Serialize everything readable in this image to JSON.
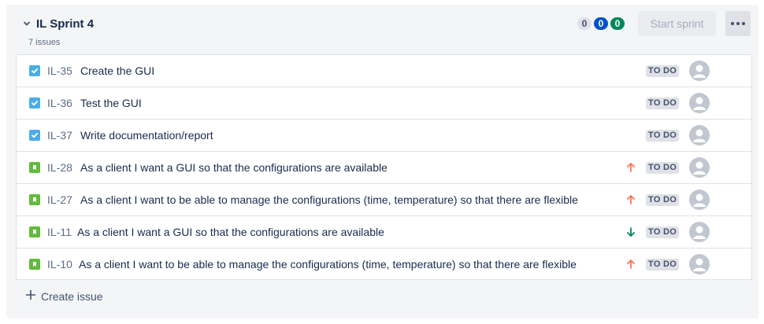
{
  "sprint": {
    "title": "IL Sprint 4",
    "issue_count": "7 issues",
    "badges": {
      "todo": "0",
      "in_progress": "0",
      "done": "0"
    },
    "start_button": "Start sprint",
    "create_issue": "Create issue"
  },
  "issues": [
    {
      "type": "task-icon",
      "key": "IL-35",
      "summary": "Create the GUI",
      "priority": "",
      "status": "TO DO"
    },
    {
      "type": "task-icon",
      "key": "IL-36",
      "summary": "Test the GUI",
      "priority": "",
      "status": "TO DO"
    },
    {
      "type": "task-icon",
      "key": "IL-37",
      "summary": "Write documentation/report",
      "priority": "",
      "status": "TO DO"
    },
    {
      "type": "story-icon",
      "key": "IL-28",
      "summary": "As a client I want a GUI so that the configurations are available",
      "priority": "high",
      "status": "TO DO"
    },
    {
      "type": "story-icon",
      "key": "IL-27",
      "summary": "As a client I want to be able to manage the configurations (time, temperature) so that there are flexible",
      "priority": "high",
      "status": "TO DO"
    },
    {
      "type": "story-icon",
      "key": "IL-11",
      "summary": "As a client I want a GUI so that the configurations are available",
      "priority": "low",
      "status": "TO DO"
    },
    {
      "type": "story-icon",
      "key": "IL-10",
      "summary": "As a client I want to be able to manage the configurations (time, temperature) so that there are flexible",
      "priority": "high",
      "status": "TO DO"
    }
  ],
  "colors": {
    "task": "#4bade8",
    "story": "#63ba3c",
    "priority_high": "#ff7452",
    "priority_low": "#00875a",
    "badge_blue": "#0052cc",
    "badge_green": "#00875a"
  }
}
